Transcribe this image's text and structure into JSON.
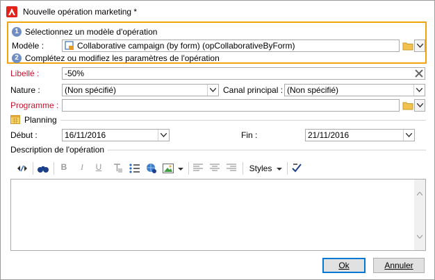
{
  "window": {
    "title": "Nouvelle opération marketing *"
  },
  "section_model": {
    "step1": "1",
    "step1_label": "Sélectionnez un modèle d'opération",
    "model_label": "Modèle :",
    "model_value": "Collaborative campaign (by form) (opCollaborativeByForm)",
    "step2": "2",
    "step2_label": "Complétez ou modifiez les paramètres de l'opération"
  },
  "form": {
    "libelle_label": "Libellé :",
    "libelle_value": "-50%",
    "nature_label": "Nature :",
    "nature_value": "(Non spécifié)",
    "canal_label": "Canal principal :",
    "canal_value": "(Non spécifié)",
    "programme_label": "Programme :",
    "programme_value": ""
  },
  "planning": {
    "header": "Planning",
    "debut_label": "Début :",
    "debut_value": "16/11/2016",
    "fin_label": "Fin :",
    "fin_value": "21/11/2016"
  },
  "description": {
    "header": "Description de l'opération",
    "toolbar": {
      "bold": "B",
      "italic": "I",
      "underline": "U",
      "styles": "Styles"
    }
  },
  "buttons": {
    "ok": "Ok",
    "cancel": "Annuler"
  },
  "colors": {
    "highlight": "#f0a30a",
    "required": "#c8102e",
    "step": "#6f8fc4",
    "accent": "#0078d7"
  }
}
